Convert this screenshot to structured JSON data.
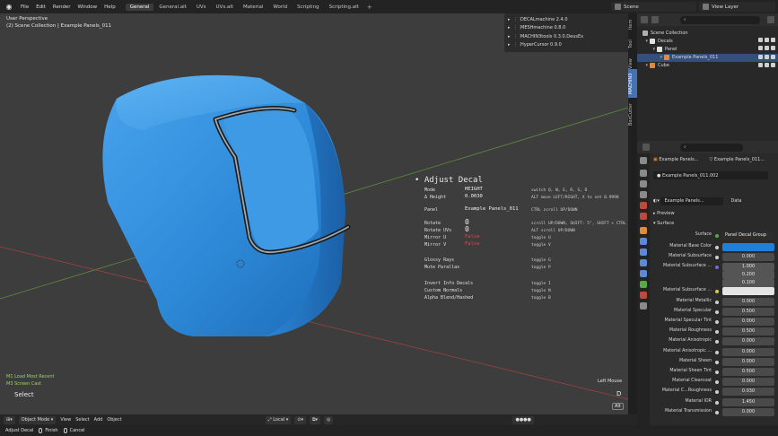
{
  "topbar": {
    "menus": [
      "File",
      "Edit",
      "Render",
      "Window",
      "Help"
    ],
    "workspaces": [
      {
        "label": "General",
        "active": true
      },
      {
        "label": "General.alt",
        "active": false
      },
      {
        "label": "UVs",
        "active": false
      },
      {
        "label": "UVs.alt",
        "active": false
      },
      {
        "label": "Material",
        "active": false
      },
      {
        "label": "World",
        "active": false
      },
      {
        "label": "Scripting",
        "active": false
      },
      {
        "label": "Scripting.alt",
        "active": false
      }
    ],
    "add_tab": "+",
    "scene": "Scene",
    "view_layer": "View Layer"
  },
  "viewport": {
    "perspective": "User Perspective",
    "collection_path": "(2) Scene Collection | Example Panels_011",
    "cube_color": "#2e8ad8",
    "status_line_1": "M1 Load Most Recent",
    "status_line_2": "M3 Screen Cast",
    "select_label": "Select",
    "left_mouse": "Left Mouse",
    "key_d": "D",
    "key_alt": "Alt"
  },
  "addons": [
    {
      "label": "DECALmachine 2.4.0"
    },
    {
      "label": "MESHmachine 0.8.0"
    },
    {
      "label": "MACHIN3tools 0.3.0.DeusEx"
    },
    {
      "label": "HyperCursor 0.9.0"
    }
  ],
  "side_tabs": [
    "Item",
    "Tool",
    "View",
    "MACHIN3",
    "BoxCutter"
  ],
  "adjust_decal": {
    "title": "Adjust Decal",
    "rows": [
      {
        "label": "Mode",
        "value": "HEIGHT",
        "hint": "switch Q, W, E, R, S, D",
        "style": "normal"
      },
      {
        "label": "Δ Height",
        "value": "0.0030",
        "hint": "ALT move LEFT/RIGHT, X to set 0.9998",
        "style": "normal"
      },
      {
        "label": "Panel",
        "value": "Example Panels_011",
        "hint": "CTRL scroll UP/DOWN",
        "style": "normal"
      },
      {
        "label": "Rotate",
        "value": "0",
        "hint": "scroll UP/DOWN, SHIFT: 5°, SHIFT + CTRL",
        "style": "big"
      },
      {
        "label": "Rotate UVs",
        "value": "0",
        "hint": "ALT scroll UP/DOWN",
        "style": "big"
      },
      {
        "label": "Mirror U",
        "value": "False",
        "hint": "toggle U",
        "style": "red"
      },
      {
        "label": "Mirror V",
        "value": "False",
        "hint": "toggle V",
        "style": "red"
      },
      {
        "label": "Glossy Rays",
        "value": "",
        "hint": "toggle G",
        "style": "normal"
      },
      {
        "label": "Mute Parallax",
        "value": "",
        "hint": "toggle P",
        "style": "normal"
      },
      {
        "label": "Invert Info Decals",
        "value": "",
        "hint": "toggle I",
        "style": "normal"
      },
      {
        "label": "Custom Normals",
        "value": "",
        "hint": "toggle N",
        "style": "normal"
      },
      {
        "label": "Alpha Blend/Hashed",
        "value": "",
        "hint": "toggle B",
        "style": "normal"
      }
    ]
  },
  "viewport_header": {
    "mode": "Object Mode",
    "menus": [
      "View",
      "Select",
      "Add",
      "Object"
    ],
    "transform": "Local"
  },
  "statusbar": {
    "items": [
      "Adjust Decal",
      "Finish",
      "Cancel"
    ]
  },
  "outliner": {
    "search_placeholder": "",
    "rows": [
      {
        "label": "Scene Collection",
        "depth": 0,
        "selected": false,
        "icon_color": "#b0b0b0"
      },
      {
        "label": "Decals",
        "depth": 1,
        "selected": false,
        "icon_color": "#e0e0e0"
      },
      {
        "label": "Panel",
        "depth": 2,
        "selected": false,
        "icon_color": "#e0e0e0"
      },
      {
        "label": "Example Panels_011",
        "depth": 3,
        "selected": true,
        "icon_color": "#e08a3c"
      },
      {
        "label": "Cube",
        "depth": 1,
        "selected": false,
        "icon_color": "#e08a3c"
      }
    ]
  },
  "properties": {
    "object_name": "Example Panels...",
    "object_name_2": "Example Panels_011...",
    "material_slot": "Example Panels_011.002",
    "material_name": "Example Panels...",
    "data_tab": "Data",
    "preview_label": "Preview",
    "surface_section": "Surface",
    "surface_label": "Surface",
    "surface_value": "Panel Decal Group",
    "materials": [
      {
        "label": "Material Base Color",
        "value": "",
        "kind": "blue",
        "dot": "normal"
      },
      {
        "label": "Material Subsurface",
        "value": "0.000",
        "kind": "num",
        "dot": "normal"
      },
      {
        "label": "Material Subsurface ...",
        "value": "1.000",
        "kind": "stack",
        "dot": "purple"
      },
      {
        "label": "",
        "value": "0.200",
        "kind": "stack",
        "dot": "none"
      },
      {
        "label": "",
        "value": "0.100",
        "kind": "stack",
        "dot": "none"
      },
      {
        "label": "Material Subsurface ...",
        "value": "",
        "kind": "white",
        "dot": "yellow"
      },
      {
        "label": "Material Metallic",
        "value": "0.000",
        "kind": "num",
        "dot": "normal"
      },
      {
        "label": "Material Specular",
        "value": "0.500",
        "kind": "num",
        "dot": "normal"
      },
      {
        "label": "Material Specular Tint",
        "value": "0.000",
        "kind": "num",
        "dot": "normal"
      },
      {
        "label": "Material Roughness",
        "value": "0.500",
        "kind": "num",
        "dot": "normal"
      },
      {
        "label": "Material Anisotropic",
        "value": "0.000",
        "kind": "num",
        "dot": "normal"
      },
      {
        "label": "Material Anisotropic ...",
        "value": "0.000",
        "kind": "num",
        "dot": "normal"
      },
      {
        "label": "Material Sheen",
        "value": "0.000",
        "kind": "num",
        "dot": "normal"
      },
      {
        "label": "Material Sheen Tint",
        "value": "0.500",
        "kind": "num",
        "dot": "normal"
      },
      {
        "label": "Material Clearcoat",
        "value": "0.000",
        "kind": "num",
        "dot": "normal"
      },
      {
        "label": "Material C...Roughness",
        "value": "0.030",
        "kind": "num",
        "dot": "normal"
      },
      {
        "label": "Material IOR",
        "value": "1.450",
        "kind": "num",
        "dot": "normal"
      },
      {
        "label": "Material Transmission",
        "value": "0.000",
        "kind": "num",
        "dot": "normal"
      }
    ]
  }
}
